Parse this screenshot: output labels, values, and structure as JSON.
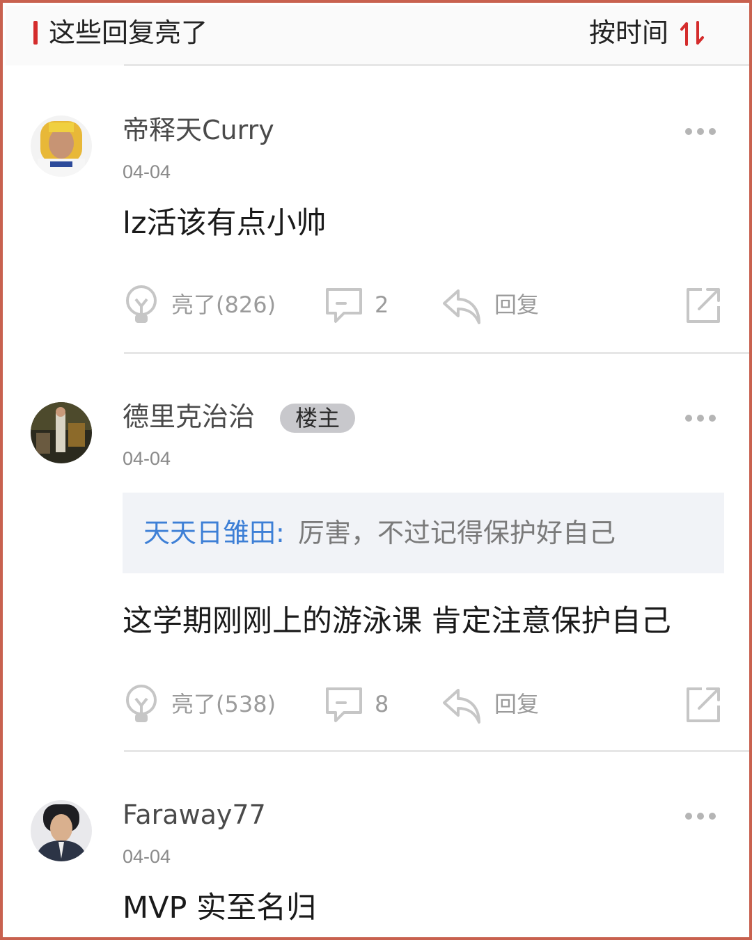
{
  "header": {
    "title": "这些回复亮了",
    "sort_label": "按时间",
    "accent_color": "#d42c2c"
  },
  "comments": [
    {
      "username": "帝释天Curry",
      "date": "04-04",
      "text": "lz活该有点小帅",
      "actions": {
        "like": "亮了(826)",
        "reply_count": "2",
        "reply": "回复"
      }
    },
    {
      "username": "德里克治治",
      "badge": "楼主",
      "date": "04-04",
      "quote_user": "天天日雏田:",
      "quote_text": "厉害，不过记得保护好自己",
      "text": "这学期刚刚上的游泳课 肯定注意保护自己",
      "actions": {
        "like": "亮了(538)",
        "reply_count": "8",
        "reply": "回复"
      }
    },
    {
      "username": "Faraway77",
      "date": "04-04",
      "text": "MVP 实至名归"
    }
  ],
  "icons": {
    "like": "lightbulb-icon",
    "comment": "speech-bubble-icon",
    "reply": "reply-arrow-icon",
    "share": "share-icon",
    "more": "more-dots-icon",
    "sort": "sort-arrows-icon"
  }
}
